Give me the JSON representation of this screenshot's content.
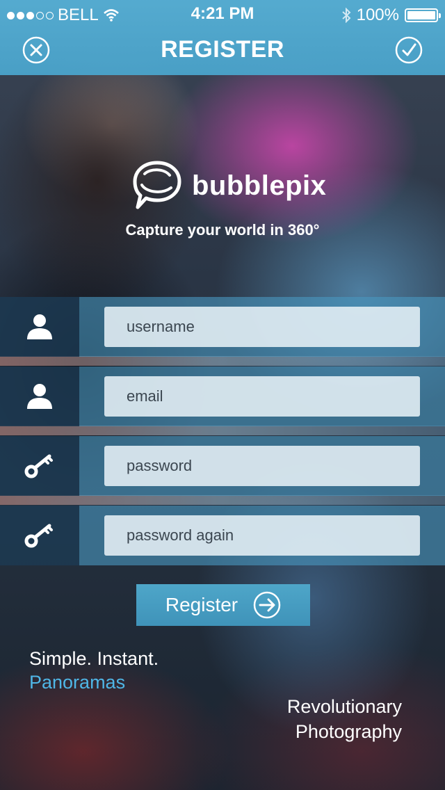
{
  "status_bar": {
    "carrier": "BELL",
    "time": "4:21 PM",
    "battery": "100%",
    "signal_icon": "signal-dots-icon",
    "wifi_icon": "wifi-icon",
    "bluetooth_icon": "bluetooth-icon",
    "battery_icon": "battery-icon"
  },
  "header": {
    "title": "REGISTER",
    "close_icon": "close-icon",
    "confirm_icon": "check-icon"
  },
  "brand": {
    "name": "bubblepix",
    "tagline": "Capture your world in 360°",
    "logo_icon": "speech-bubble-logo-icon"
  },
  "form": {
    "fields": [
      {
        "placeholder": "username",
        "icon": "user-icon"
      },
      {
        "placeholder": "email",
        "icon": "user-icon"
      },
      {
        "placeholder": "password",
        "icon": "key-icon"
      },
      {
        "placeholder": "password again",
        "icon": "key-icon"
      }
    ],
    "submit_label": "Register",
    "submit_icon": "arrow-right-circle-icon"
  },
  "slogans": {
    "line1": "Simple. Instant.",
    "line2": "Panoramas",
    "line3": "Revolutionary",
    "line4": "Photography"
  },
  "colors": {
    "header_bg": "#56B0D6",
    "accent": "#4FB6E6",
    "icon_cell_bg": "#1C3A52"
  }
}
